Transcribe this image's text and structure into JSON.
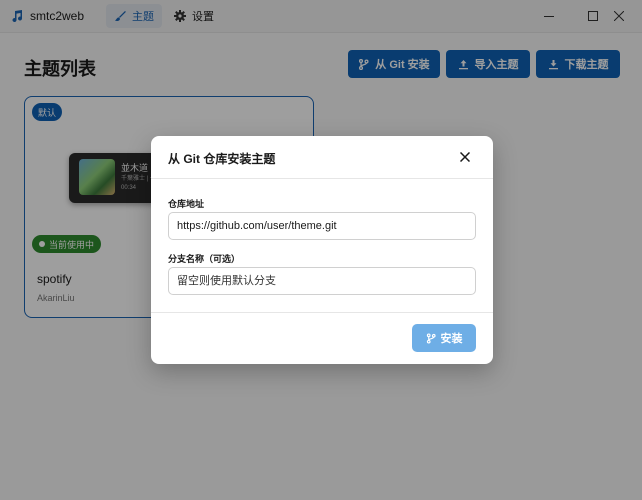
{
  "app": {
    "name": "smtc2web"
  },
  "nav": {
    "themes_label": "主题",
    "settings_label": "设置"
  },
  "page": {
    "title": "主题列表"
  },
  "toolbar": {
    "git_install_label": "从 Git 安装",
    "import_label": "导入主题",
    "download_label": "下载主题"
  },
  "theme_card": {
    "default_badge": "默认",
    "preview_song": "並木道",
    "preview_sub": "千葉雅士 | 七",
    "preview_time": "00:34",
    "current_badge": "当前使用中",
    "name": "spotify",
    "author": "AkarinLiu"
  },
  "dialog": {
    "title": "从 Git 仓库安装主题",
    "repo_label": "仓库地址",
    "repo_value": "https://github.com/user/theme.git",
    "branch_label": "分支名称（可选）",
    "branch_placeholder": "留空则使用默认分支",
    "install_label": "安装"
  },
  "colors": {
    "accent": "#0f62b5",
    "install_disabled": "#6eaee6",
    "current_badge": "#2e8b2e"
  },
  "icons": {
    "app": "music-note-icon",
    "themes": "brush-icon",
    "settings": "gear-icon",
    "git": "git-branch-icon",
    "import": "upload-icon",
    "download": "download-icon",
    "close": "close-icon"
  }
}
